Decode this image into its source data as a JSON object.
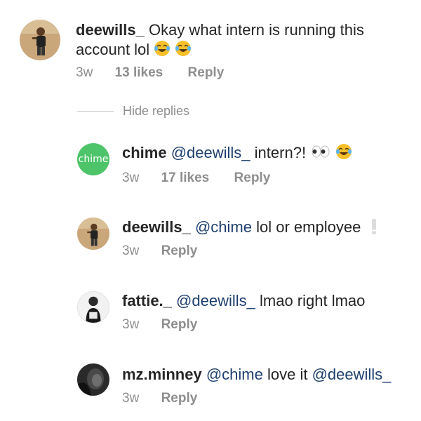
{
  "comments": [
    {
      "username": "deewills_",
      "text_line1": "Okay what intern is running this",
      "text_line2": "account lol",
      "emoji": [
        "face-with-tears-of-joy-icon",
        "face-with-tears-of-joy-icon"
      ],
      "time": "3w",
      "likes": "13 likes",
      "reply_label": "Reply"
    }
  ],
  "hide_replies_label": "Hide replies",
  "replies": [
    {
      "username": "chime",
      "avatar_text": "chime",
      "mention": "@deewills_",
      "text": "intern?!",
      "emoji": [
        "eyes-icon",
        "face-with-tears-of-joy-icon"
      ],
      "time": "3w",
      "likes": "17 likes",
      "reply_label": "Reply"
    },
    {
      "username": "deewills_",
      "mention": "@chime",
      "text": "lol or employee",
      "emoji": [
        "exclamation-icon"
      ],
      "time": "3w",
      "reply_label": "Reply"
    },
    {
      "username": "fattie._",
      "mention": "@deewills_",
      "text": "lmao right lmao",
      "time": "3w",
      "reply_label": "Reply"
    },
    {
      "username": "mz.minney",
      "mention": "@chime",
      "text": "love it",
      "mention2": "@deewills_",
      "time": "3w",
      "reply_label": "Reply"
    }
  ],
  "colors": {
    "username": "#262626",
    "mention": "#1d3f6e",
    "meta": "#8e8e8e",
    "chime_green": "#4ec46a"
  }
}
